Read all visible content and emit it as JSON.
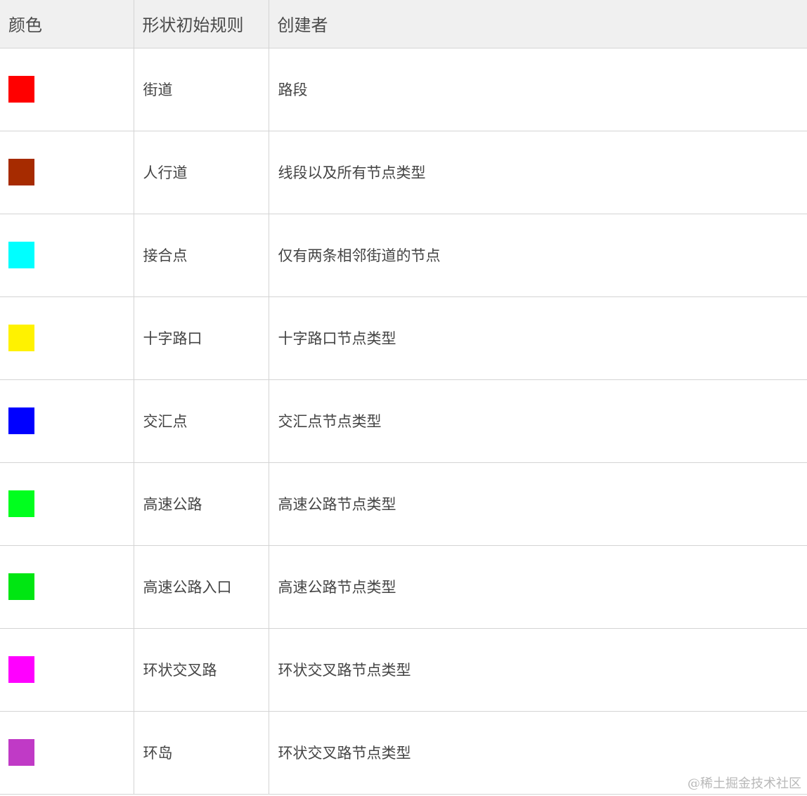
{
  "table": {
    "headers": {
      "color": "颜色",
      "rule": "形状初始规则",
      "creator": "创建者"
    },
    "rows": [
      {
        "swatch_color": "#ff0000",
        "rule": "街道",
        "creator": "路段"
      },
      {
        "swatch_color": "#a62b00",
        "rule": "人行道",
        "creator": "线段以及所有节点类型"
      },
      {
        "swatch_color": "#00ffff",
        "rule": "接合点",
        "creator": "仅有两条相邻街道的节点"
      },
      {
        "swatch_color": "#fff200",
        "rule": "十字路口",
        "creator": "十字路口节点类型"
      },
      {
        "swatch_color": "#0000ff",
        "rule": "交汇点",
        "creator": "交汇点节点类型"
      },
      {
        "swatch_color": "#00ff1e",
        "rule": "高速公路",
        "creator": "高速公路节点类型"
      },
      {
        "swatch_color": "#00e612",
        "rule": "高速公路入口",
        "creator": "高速公路节点类型"
      },
      {
        "swatch_color": "#ff00ff",
        "rule": "环状交叉路",
        "creator": "环状交叉路节点类型"
      },
      {
        "swatch_color": "#c03ac6",
        "rule": "环岛",
        "creator": "环状交叉路节点类型"
      }
    ]
  },
  "watermark": "@稀土掘金技术社区"
}
